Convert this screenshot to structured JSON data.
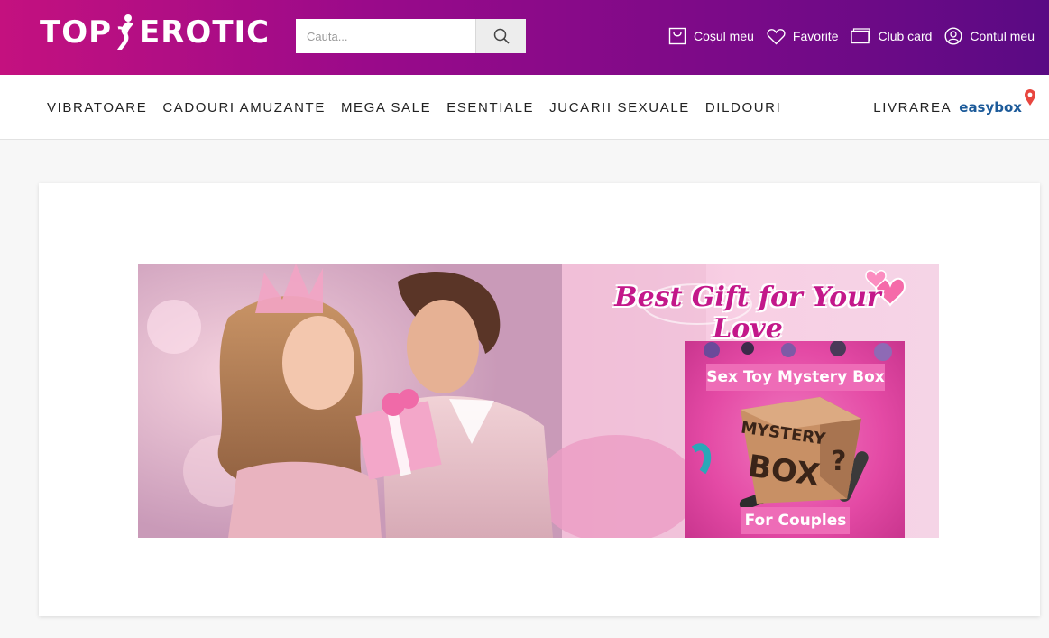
{
  "header": {
    "logo_left": "TOP",
    "logo_right": "EROTIC",
    "search_placeholder": "Cauta...",
    "links": [
      {
        "label": "Coșul meu",
        "icon": "bag-icon"
      },
      {
        "label": "Favorite",
        "icon": "heart-icon"
      },
      {
        "label": "Club card",
        "icon": "card-icon"
      },
      {
        "label": "Contul meu",
        "icon": "user-icon"
      }
    ]
  },
  "nav": {
    "items": [
      "VIBRATOARE",
      "CADOURI AMUZANTE",
      "MEGA SALE",
      "ESENTIALE",
      "JUCARII SEXUALE",
      "DILDOURI"
    ],
    "delivery_label": "LIVRAREA",
    "delivery_brand": "easybox"
  },
  "banner": {
    "headline": "Best Gift for Your Love",
    "tag_top": "Sex Toy Mystery Box",
    "box_line1": "MYSTERY",
    "box_line2": "BOX",
    "box_mark": "?",
    "tag_bottom": "For Couples"
  },
  "colors": {
    "header_start": "#c4117f",
    "header_end": "#5a0a84",
    "banner_pink": "#c3188a",
    "easybox_blue": "#1d5b9a",
    "easybox_pin": "#e8463f"
  }
}
